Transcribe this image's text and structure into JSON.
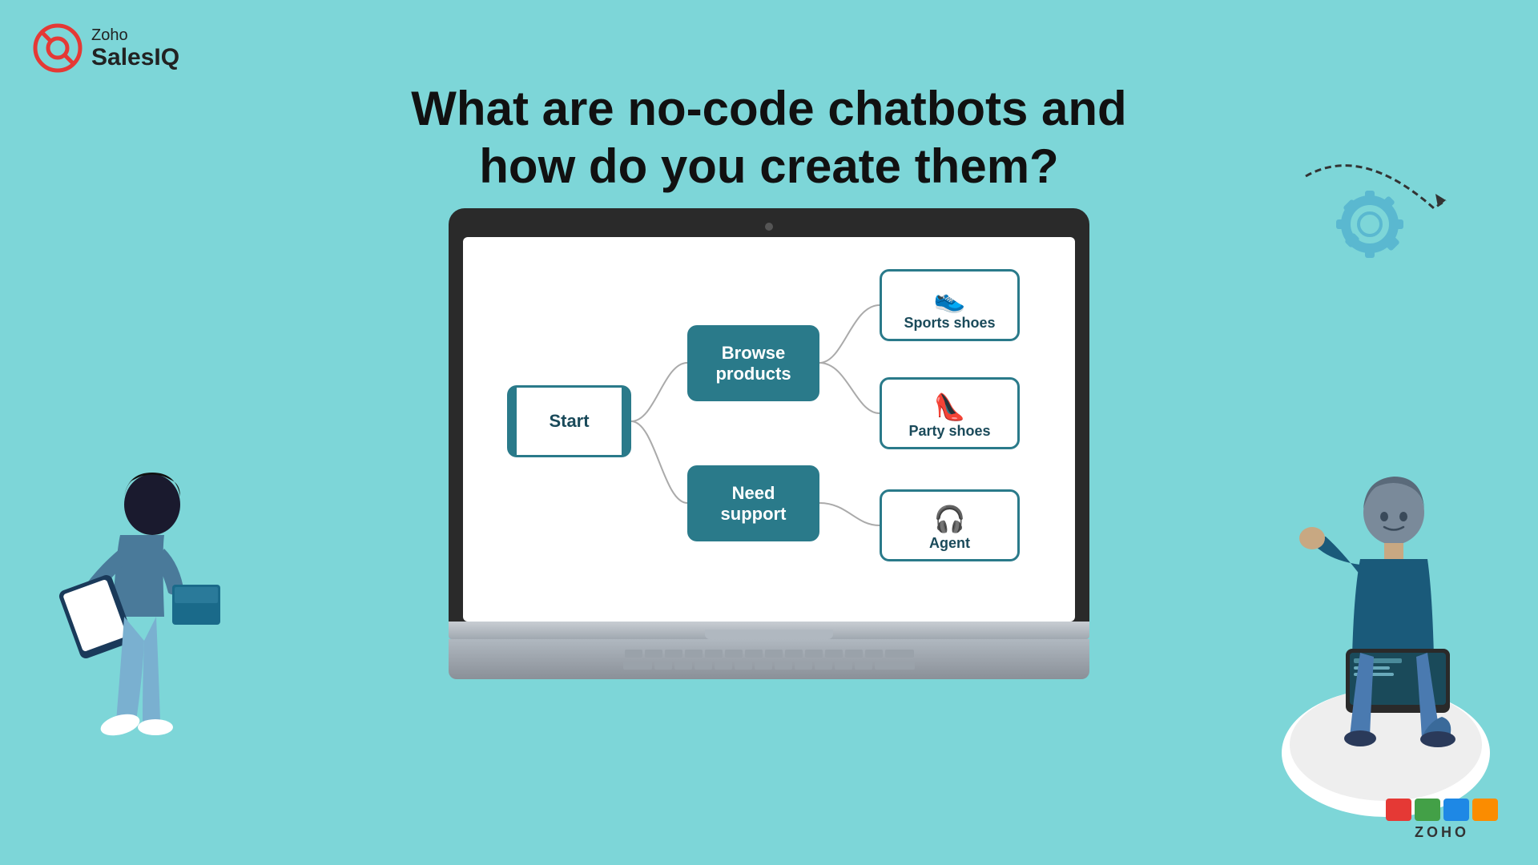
{
  "brand": {
    "zoho_label": "Zoho",
    "salesiq_label": "SalesIQ",
    "zoho_footer": "ZOHO"
  },
  "heading": {
    "line1": "What are no-code chatbots and",
    "line2": "how do you create them?"
  },
  "flowchart": {
    "start_label": "Start",
    "browse_label": "Browse\nproducts",
    "support_label": "Need\nsupport",
    "sports_label": "Sports shoes",
    "party_label": "Party shoes",
    "agent_label": "Agent"
  },
  "colors": {
    "bg": "#7dd6d8",
    "teal": "#2a7a8a",
    "white": "#ffffff",
    "dark": "#111111"
  },
  "zoho_squares": [
    {
      "color": "#e53935"
    },
    {
      "color": "#43a047"
    },
    {
      "color": "#1e88e5"
    },
    {
      "color": "#fb8c00"
    }
  ]
}
